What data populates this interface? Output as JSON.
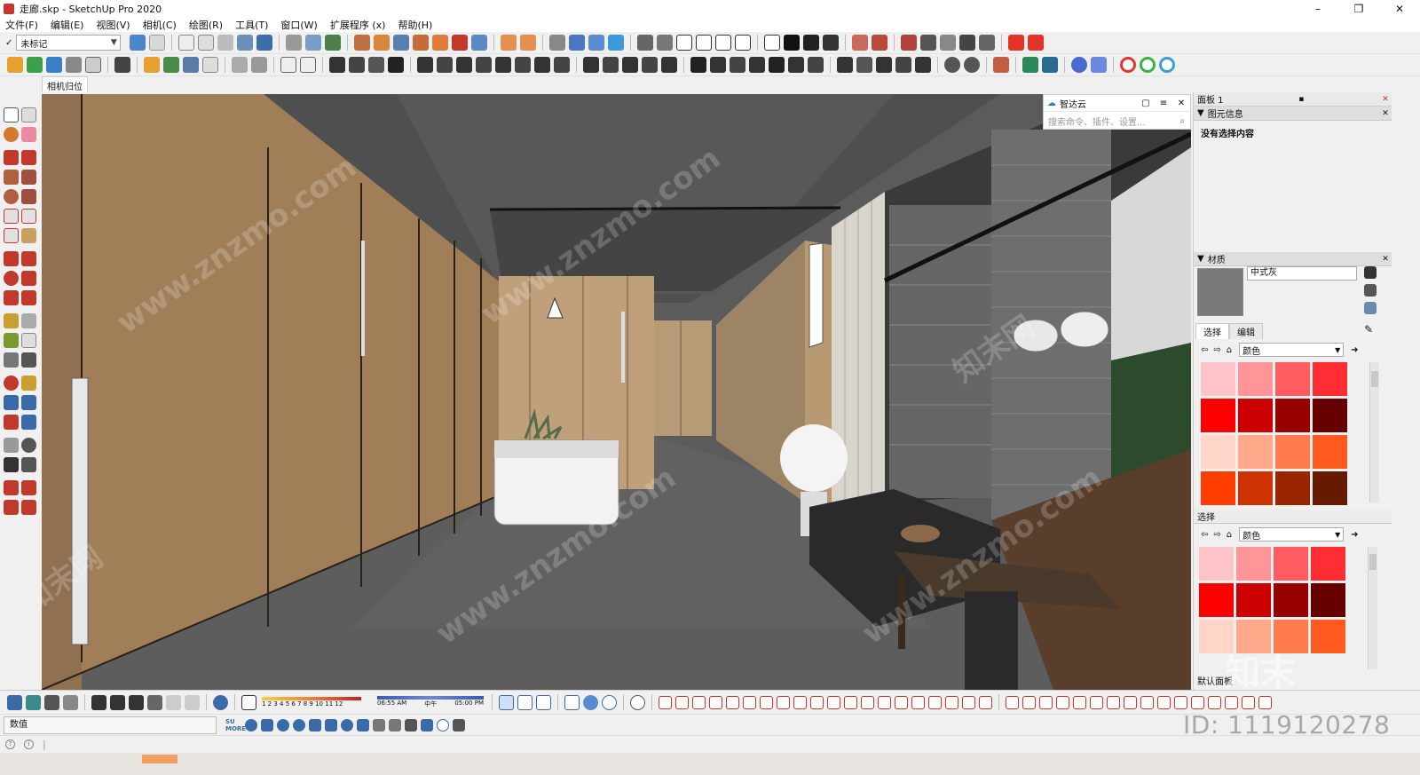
{
  "window": {
    "title": "走廊.skp - SketchUp Pro 2020",
    "controls": [
      "–",
      "❐",
      "✕"
    ]
  },
  "menu": [
    "文件(F)",
    "编辑(E)",
    "视图(V)",
    "相机(C)",
    "绘图(R)",
    "工具(T)",
    "窗口(W)",
    "扩展程序 (x)",
    "帮助(H)"
  ],
  "toolbar": {
    "tag_label": "未标记",
    "tag_check": "✓"
  },
  "scene_tab": "相机归位",
  "zhidayun": {
    "title": "智达云",
    "search_placeholder": "搜索命令、插件、设置..."
  },
  "tray": {
    "title": "面板 1",
    "entity_info": {
      "header": "图元信息",
      "text": "没有选择内容"
    },
    "materials": {
      "header": "材质",
      "name": "中式灰",
      "tab_select": "选择",
      "tab_edit": "编辑",
      "dropdown": "颜色",
      "swatches": [
        "#ffc4c8",
        "#ff9499",
        "#ff5c62",
        "#ff2d34",
        "#ff0000",
        "#cc0000",
        "#990000",
        "#660000",
        "#ffd5c8",
        "#ffa88a",
        "#ff7a4d",
        "#ff5a1f",
        "#ff3d00",
        "#cc3300",
        "#992600",
        "#661a00"
      ]
    },
    "select2": {
      "header": "选择",
      "dropdown": "颜色",
      "swatches": [
        "#ffc4c8",
        "#ff9499",
        "#ff5c62",
        "#ff2d34",
        "#ff0000",
        "#cc0000",
        "#990000",
        "#660000",
        "#ffd5c8",
        "#ffa88a",
        "#ff7a4d",
        "#ff5a1f",
        "#ff3d00",
        "#cc3300",
        "#992600",
        "#661a00"
      ]
    },
    "footer": "默认面板"
  },
  "bottom": {
    "scale_numbers": "1 2 3 4 5 6 7 8 9 10 11 12",
    "time_start": "06:55 AM",
    "time_mid": "中午",
    "time_end": "05:00 PM",
    "su_more": "SU MORE"
  },
  "status": {
    "measure_label": "数值"
  },
  "watermark": {
    "text": "www.znzmo.com",
    "cn": "知末网",
    "logo": "知末",
    "id": "ID: 1119120278"
  },
  "colors": {
    "wood": "#a8865e",
    "brick": "#6c6c6c",
    "floor": "#5c5c5c",
    "ceiling": "#4d4d4d"
  }
}
